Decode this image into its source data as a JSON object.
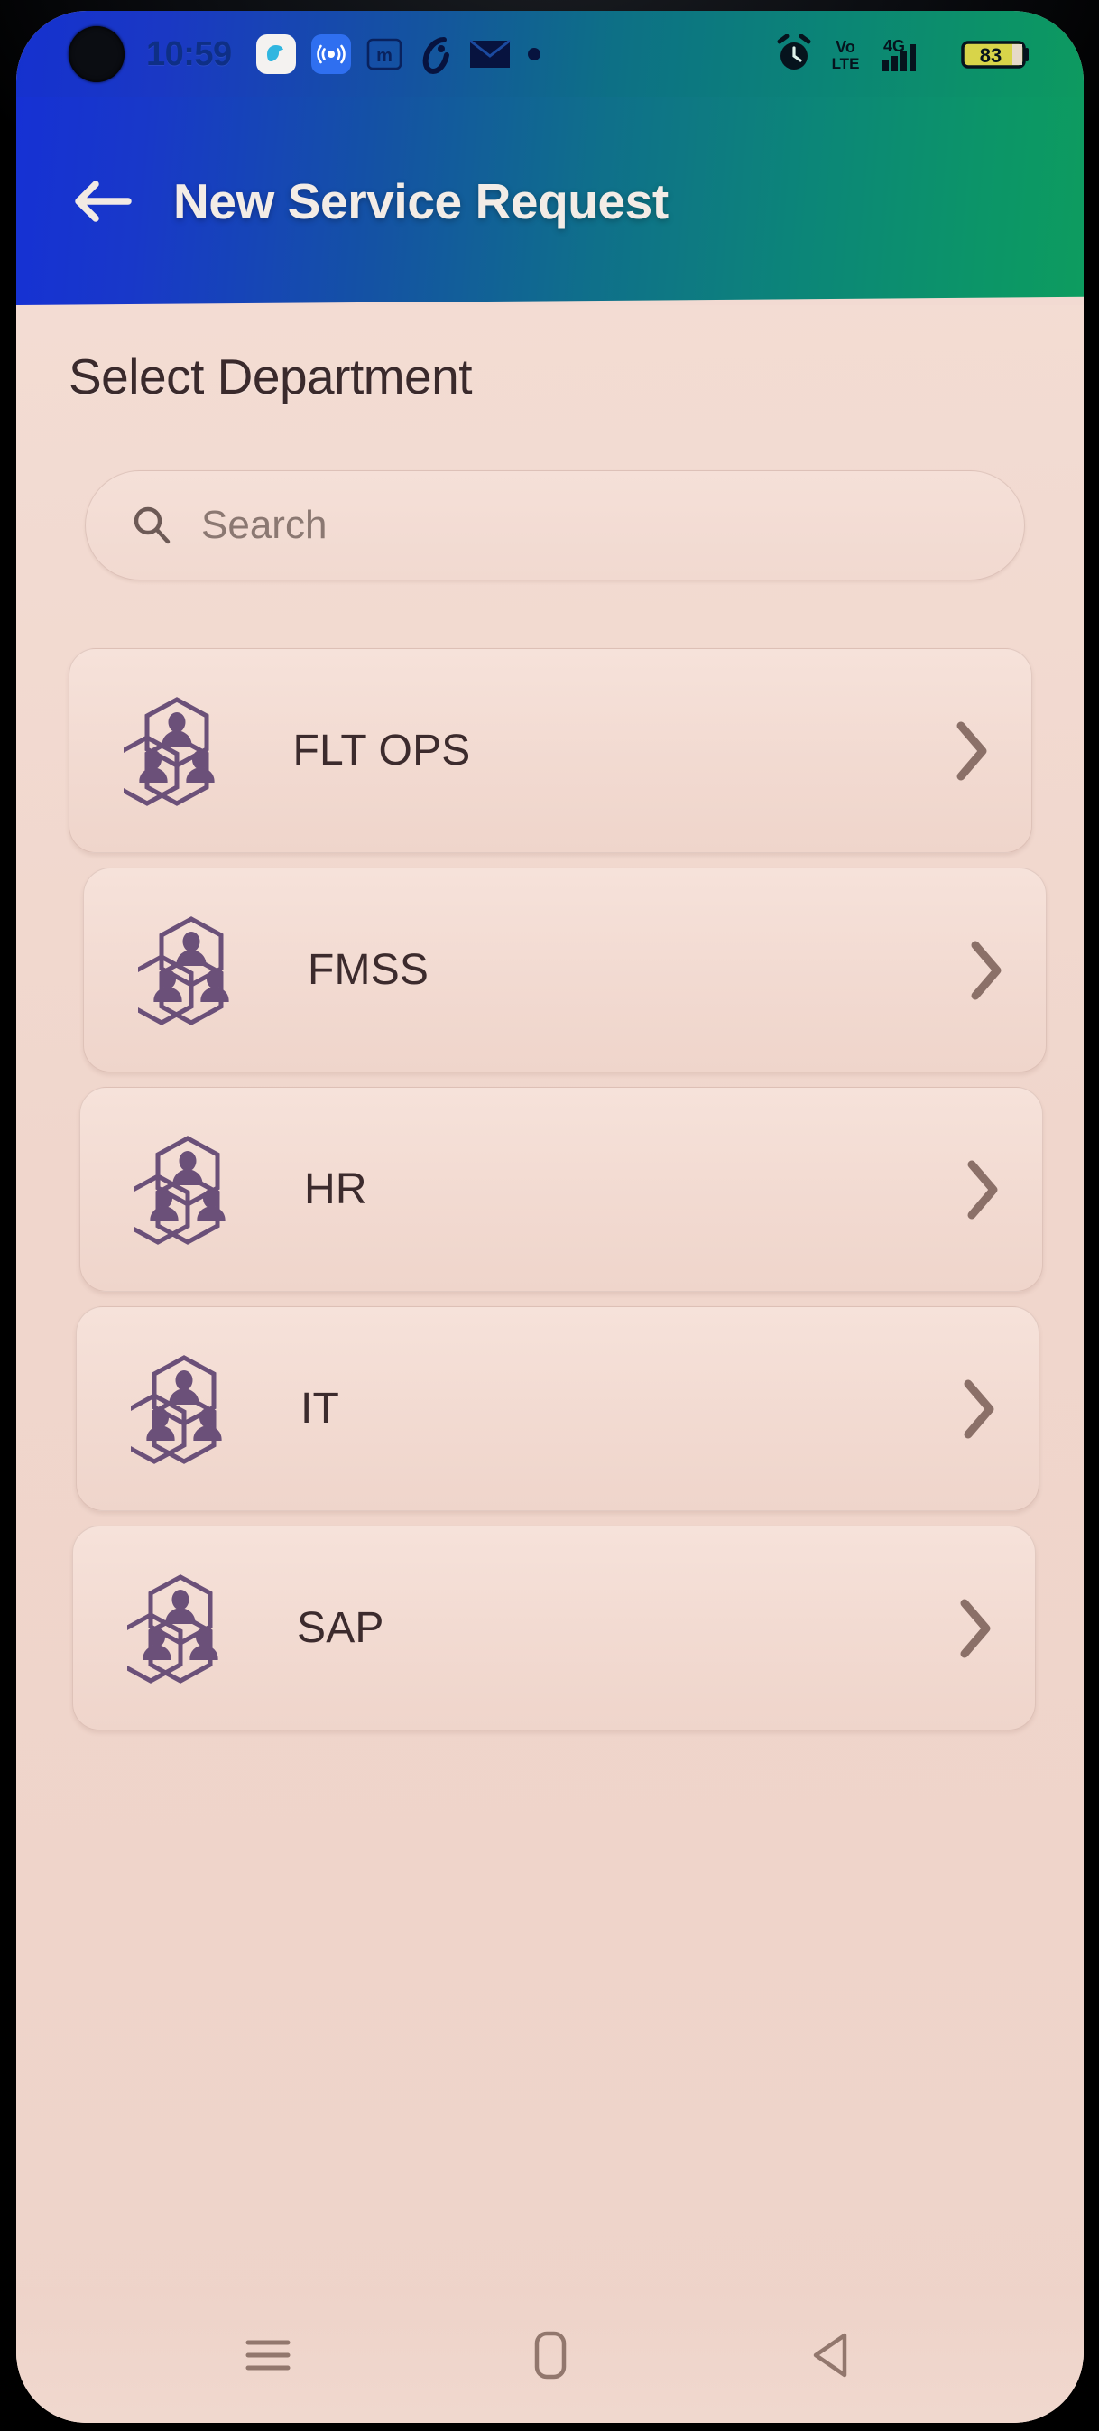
{
  "status_bar": {
    "clock": "10:59",
    "notification_icons": [
      "app-white-rounded-icon",
      "broadcast-app-icon",
      "m-app-icon",
      "airtel-icon",
      "envelope-icon",
      "dot-icon"
    ],
    "right_icons": [
      "alarm-clock-icon",
      "volte-icon",
      "4g-signal-icon"
    ],
    "volte_top": "Vo",
    "volte_bottom": "LTE",
    "network_label": "4G",
    "battery_percent": "83"
  },
  "app_bar": {
    "back_icon": "arrow-left-icon",
    "title": "New Service Request",
    "gradient_from": "#1631d4",
    "gradient_to": "#0d9c5f"
  },
  "page": {
    "title": "Select Department",
    "background": "#f0d6cc"
  },
  "search": {
    "placeholder": "Search",
    "value": "",
    "icon": "search-icon"
  },
  "departments": [
    {
      "label": "FLT OPS",
      "icon": "org-team-hexagon-icon",
      "chevron": "chevron-right-icon"
    },
    {
      "label": "FMSS",
      "icon": "org-team-hexagon-icon",
      "chevron": "chevron-right-icon"
    },
    {
      "label": "HR",
      "icon": "org-team-hexagon-icon",
      "chevron": "chevron-right-icon"
    },
    {
      "label": "IT",
      "icon": "org-team-hexagon-icon",
      "chevron": "chevron-right-icon"
    },
    {
      "label": "SAP",
      "icon": "org-team-hexagon-icon",
      "chevron": "chevron-right-icon"
    }
  ],
  "colors": {
    "icon_purple": "#6e5480",
    "chevron": "#8b7068",
    "text_dark": "#3c2b2d",
    "placeholder": "#8b7872"
  },
  "nav_bar": {
    "buttons": [
      "recents-menu-icon",
      "home-square-icon",
      "back-triangle-icon"
    ]
  }
}
